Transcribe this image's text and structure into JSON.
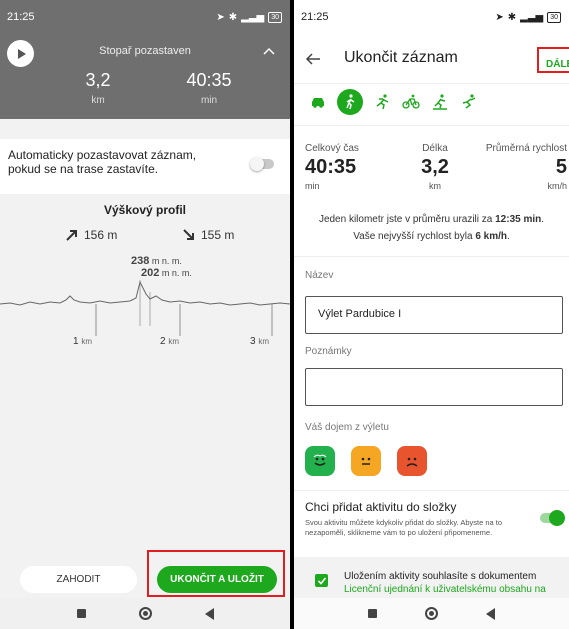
{
  "left": {
    "status": {
      "time": "21:25",
      "battery": "30"
    },
    "tracker": {
      "title": "Stopař pozastaven",
      "distance": "3,2",
      "distance_unit": "km",
      "duration": "40:35",
      "duration_unit": "min"
    },
    "autopause": {
      "text": "Automaticky pozastavovat záznam, pokud se na trase zastavíte.",
      "enabled": false
    },
    "profile": {
      "title": "Výškový profil",
      "ascent": "156 m",
      "descent": "155 m",
      "max_alt": "238",
      "min_alt": "202",
      "alt_unit": "m n. m.",
      "km_labels": [
        "1",
        "2",
        "3"
      ],
      "km_unit": "km"
    },
    "buttons": {
      "discard": "ZAHODIT",
      "save": "UKONČIT A ULOŽIT"
    }
  },
  "right": {
    "status": {
      "time": "21:25",
      "battery": "30"
    },
    "header": {
      "title": "Ukončit záznam",
      "next": "DÁLE"
    },
    "activities": [
      "car-icon",
      "walk-icon",
      "run-icon",
      "bike-icon",
      "ski-icon",
      "crosscountry-icon"
    ],
    "selected_activity": "walk-icon",
    "stats": [
      {
        "label": "Celkový čas",
        "value": "40:35",
        "unit": "min"
      },
      {
        "label": "Délka",
        "value": "3,2",
        "unit": "km"
      },
      {
        "label": "Průměrná rychlost",
        "value": "5",
        "unit": "km/h"
      }
    ],
    "info": {
      "line1_pre": "Jeden kilometr jste v průměru urazili za ",
      "line1_val": "12:35 min",
      "line1_post": ".",
      "line2_pre": "Vaše nejvyšší rychlost byla ",
      "line2_val": "6 km/h",
      "line2_post": "."
    },
    "name_label": "Název",
    "name_value": "Výlet Pardubice I",
    "notes_label": "Poznámky",
    "notes_value": "",
    "mood_label": "Váš dojem z výletu",
    "moods": [
      "happy-face-icon",
      "neutral-face-icon",
      "sad-face-icon"
    ],
    "mood_colors": [
      "#22b14c",
      "#f5a623",
      "#e8542e"
    ],
    "folder": {
      "title": "Chci přidat aktivitu do složky",
      "desc": "Svou aktivitu můžete kdykoliv přidat do složky. Abyste na to nezapoměli, sklikneme vám to po uložení připomeneme.",
      "enabled": true
    },
    "consent": {
      "text": "Uložením aktivity souhlasíte s dokumentem",
      "link": "Licenční ujednání k uživatelskému obsahu na Mapy.cz.",
      "checked": true
    }
  },
  "colors": {
    "accent": "#1da81d",
    "highlight": "#e02020",
    "tracker_bg": "#6f6f6f"
  }
}
